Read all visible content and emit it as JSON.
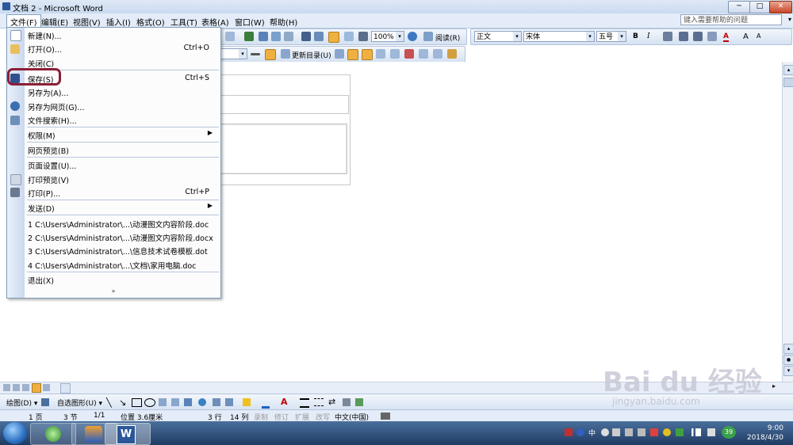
{
  "window": {
    "title": "文档 2 - Microsoft Word",
    "min": "─",
    "max": "□",
    "close": "✕"
  },
  "menubar": {
    "items": [
      "文件(F)",
      "编辑(E)",
      "视图(V)",
      "插入(I)",
      "格式(O)",
      "工具(T)",
      "表格(A)",
      "窗口(W)",
      "帮助(H)"
    ],
    "help_placeholder": "键入需要帮助的问题"
  },
  "toolbar": {
    "zoom": "100%",
    "read_label": "阅读(R)",
    "style": "正文",
    "font": "宋体",
    "size": "五号",
    "bold": "B",
    "italic": "I",
    "font_color_label": "A",
    "grow_font": "A",
    "shrink_font": "A",
    "update_toc": "更新目录(U)"
  },
  "file_menu": {
    "items": [
      {
        "label": "新建(N)...",
        "shortcut": ""
      },
      {
        "label": "打开(O)...",
        "shortcut": "Ctrl+O"
      },
      {
        "label": "关闭(C)",
        "shortcut": ""
      },
      {
        "label": "保存(S)",
        "shortcut": "Ctrl+S"
      },
      {
        "label": "另存为(A)...",
        "shortcut": ""
      },
      {
        "label": "另存为网页(G)...",
        "shortcut": ""
      },
      {
        "label": "文件搜索(H)...",
        "shortcut": ""
      },
      {
        "label": "权限(M)",
        "shortcut": ""
      },
      {
        "label": "网页预览(B)",
        "shortcut": ""
      },
      {
        "label": "页面设置(U)...",
        "shortcut": ""
      },
      {
        "label": "打印预览(V)",
        "shortcut": ""
      },
      {
        "label": "打印(P)...",
        "shortcut": "Ctrl+P"
      },
      {
        "label": "发送(D)",
        "shortcut": ""
      },
      {
        "label": "1 C:\\Users\\Administrator\\...\\动漫图文内容阶段.doc",
        "shortcut": ""
      },
      {
        "label": "2 C:\\Users\\Administrator\\...\\动漫图文内容阶段.docx",
        "shortcut": ""
      },
      {
        "label": "3 C:\\Users\\Administrator\\...\\信息技术试卷模板.dot",
        "shortcut": ""
      },
      {
        "label": "4 C:\\Users\\Administrator\\...\\文档\\家用电脑.doc",
        "shortcut": ""
      },
      {
        "label": "退出(X)",
        "shortcut": ""
      }
    ],
    "expand": "»"
  },
  "drawbar": {
    "draw": "绘图(D) ▾",
    "autoshape": "自选图形(U) ▾"
  },
  "status": {
    "page": "1 页",
    "section": "3 节",
    "pages": "1/1",
    "position": "位置 3.6厘米",
    "line": "3 行",
    "col": "14 列",
    "rec": "录制",
    "rev": "修订",
    "ext": "扩展",
    "ovr": "改写",
    "lang": "中文(中国)"
  },
  "taskbar": {
    "ime": "中",
    "badge": "39",
    "time": "9:00",
    "date": "2018/4/30"
  },
  "watermark": {
    "brand": "Bai du 经验",
    "url": "jingyan.baidu.com"
  },
  "colors": {
    "accent": "#8c1e36",
    "menu_border": "#7f9db9",
    "taskbar": "#1f3b63"
  }
}
